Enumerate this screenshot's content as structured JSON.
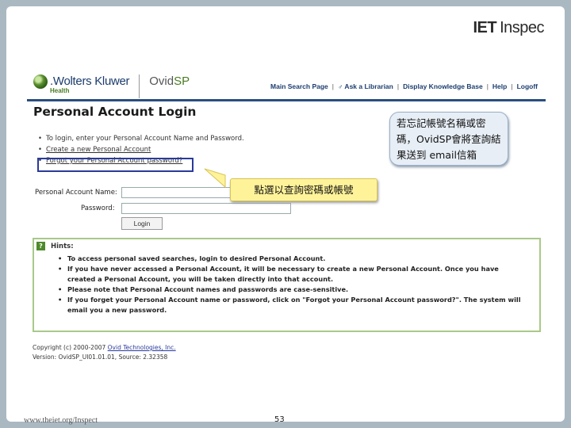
{
  "brand": {
    "bold": "IET",
    "name": "Inspec"
  },
  "ovid_page": {
    "logo": {
      "name": ".Wolters Kluwer",
      "sub": "Health"
    },
    "ovid_logo": {
      "a": "Ovid",
      "b": "SP"
    },
    "nav": [
      {
        "label": "Main Search Page"
      },
      {
        "label": "♂ Ask a Librarian"
      },
      {
        "label": "Display Knowledge Base"
      },
      {
        "label": "Help"
      },
      {
        "label": "Logoff"
      }
    ],
    "title": "Personal Account Login",
    "bullets": [
      "To login, enter your Personal Account Name and Password.",
      "Create a new Personal Account",
      "Forgot your Personal Account password?"
    ],
    "form": {
      "name_label": "Personal Account Name:",
      "password_label": "Password:",
      "login_button": "Login"
    },
    "hints": {
      "title": "Hints:",
      "items": [
        "To access personal saved searches, login to desired Personal Account.",
        "If you have never accessed a Personal Account, it will be necessary to create a new Personal Account. Once you have created a Personal Account, you will be taken directly into that account.",
        "Please note that Personal Account names and passwords are case-sensitive.",
        "If you forget your Personal Account name or password, click on \"Forgot your Personal Account password?\". The system will email you a new password."
      ]
    },
    "copyright": {
      "prefix": "Copyright (c) 2000-2007 ",
      "link": "Ovid Technologies, Inc."
    },
    "version": "Version: OvidSP_UI01.01.01, Source: 2.32358"
  },
  "callouts": {
    "top_right": "若忘記帳號名稱或密碼，OvidSP會將查詢結果送到 email信箱",
    "middle": "點選以查詢密碼或帳號"
  },
  "footer": {
    "url": "www.theiet.org/Inspect",
    "page": "53"
  }
}
